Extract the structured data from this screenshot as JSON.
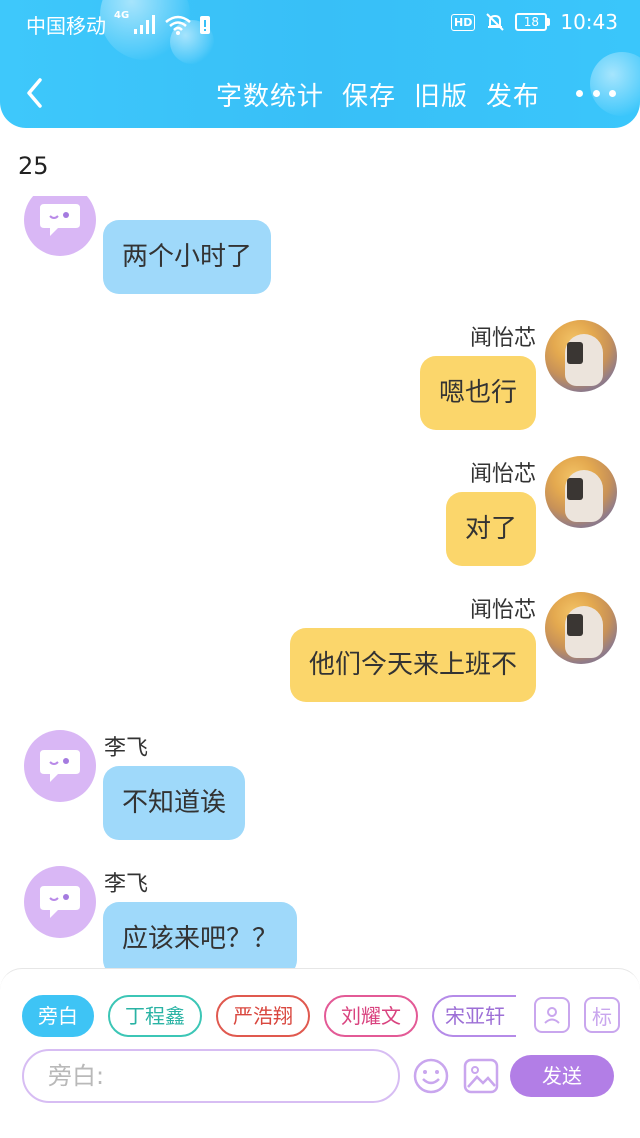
{
  "status": {
    "carrier": "中国移动",
    "network": "4G",
    "hd": "HD",
    "battery": "18",
    "time": "10:43"
  },
  "header": {
    "actions": [
      "字数统计",
      "保存",
      "旧版",
      "发布"
    ],
    "icons": {
      "back": "chevron-left-icon",
      "more": "more-dots-icon"
    }
  },
  "word_count": "25",
  "messages": [
    {
      "side": "left",
      "name": "",
      "text": "两个小时了",
      "avatar": "chat-bubble-icon"
    },
    {
      "side": "right",
      "name": "闻怡芯",
      "text": "嗯也行",
      "avatar": "user-photo"
    },
    {
      "side": "right",
      "name": "闻怡芯",
      "text": "对了",
      "avatar": "user-photo"
    },
    {
      "side": "right",
      "name": "闻怡芯",
      "text": "他们今天来上班不",
      "avatar": "user-photo"
    },
    {
      "side": "left",
      "name": "李飞",
      "text": "不知道诶",
      "avatar": "chat-bubble-icon"
    },
    {
      "side": "left",
      "name": "李飞",
      "text": "应该来吧？？",
      "avatar": "chat-bubble-icon"
    }
  ],
  "roles": [
    {
      "label": "旁白",
      "color": "#3ec4f5",
      "active": true
    },
    {
      "label": "丁程鑫",
      "color": "#3cc6b6",
      "active": false
    },
    {
      "label": "严浩翔",
      "color": "#e0594f",
      "active": false
    },
    {
      "label": "刘耀文",
      "color": "#e35a96",
      "active": false
    },
    {
      "label": "宋亚轩",
      "color": "#b58be8",
      "active": false
    }
  ],
  "role_tools": {
    "add_role_icon": "person-card-icon",
    "tag": "标"
  },
  "composer": {
    "placeholder": "旁白:",
    "send_label": "发送",
    "emoji_icon": "smiley-icon",
    "image_icon": "image-icon"
  }
}
